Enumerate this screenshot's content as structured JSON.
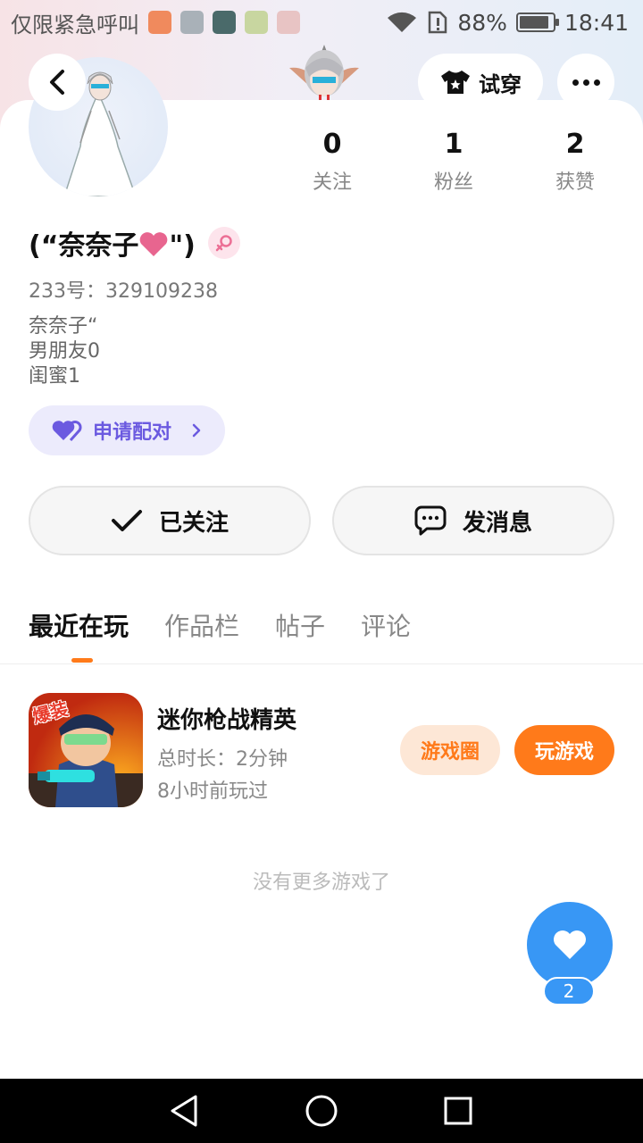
{
  "status_bar": {
    "carrier_text": "仅限紧急呼叫",
    "battery": "88%",
    "battery_level": 0.88,
    "time": "18:41"
  },
  "header": {
    "try_on_label": "试穿"
  },
  "profile": {
    "stats": [
      {
        "value": "0",
        "label": "关注"
      },
      {
        "value": "1",
        "label": "粉丝"
      },
      {
        "value": "2",
        "label": "获赞"
      }
    ],
    "name_prefix": "(“奈奈子",
    "name_suffix": "\")",
    "uid": "233号：329109238",
    "bio_lines": [
      "奈奈子“",
      "男朋友0",
      "闺蜜1"
    ],
    "pair_label": "申请配对",
    "follow_label": "已关注",
    "message_label": "发消息"
  },
  "tabs": [
    "最近在玩",
    "作品栏",
    "帖子",
    "评论"
  ],
  "active_tab": "最近在玩",
  "recent_game": {
    "title": "迷你枪战精英",
    "duration": "总时长：2分钟",
    "last_played": "8小时前玩过",
    "circle_label": "游戏圈",
    "play_label": "玩游戏",
    "icon_text": "爆装"
  },
  "no_more_text": "没有更多游戏了",
  "likes_count": "2",
  "colors": {
    "accent_orange": "#ff7a1a",
    "like_blue": "#3897f5",
    "pair_purple": "#6b5ae0"
  }
}
